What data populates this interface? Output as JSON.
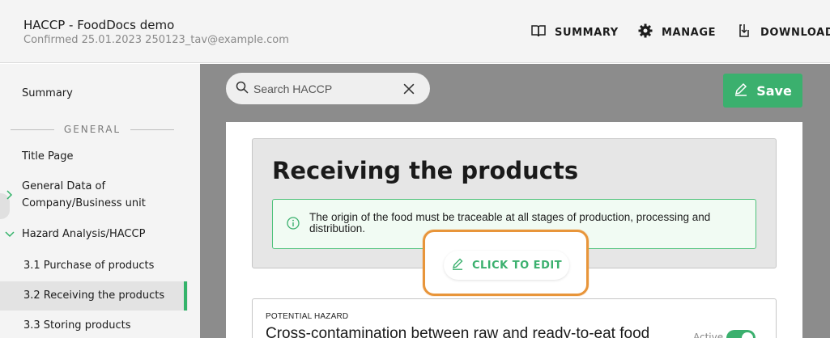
{
  "header": {
    "title": "HACCP - FoodDocs demo",
    "subtitle": "Confirmed 25.01.2023 250123_tav@example.com",
    "nav": {
      "summary": "SUMMARY",
      "manage": "MANAGE",
      "download": "DOWNLOAD"
    }
  },
  "sidebar": {
    "summary": "Summary",
    "section_general": "GENERAL",
    "title_page": "Title Page",
    "general_data_line1": "General Data of",
    "general_data_line2": "Company/Business unit",
    "hazard_analysis": "Hazard Analysis/HACCP",
    "sub_items": [
      {
        "label": "3.1 Purchase of products"
      },
      {
        "label": "3.2 Receiving the products",
        "active": true
      },
      {
        "label": "3.3 Storing products"
      }
    ]
  },
  "toolbar": {
    "search_placeholder": "Search HACCP",
    "save_label": "Save"
  },
  "step": {
    "title": "Receiving the products",
    "info_text": "The origin of the food must be traceable at all stages of production, processing and distribution.",
    "edit_label": "CLICK TO EDIT"
  },
  "hazard": {
    "label": "POTENTIAL HAZARD",
    "title": "Cross-contamination between raw and ready-to-eat food",
    "active_label": "Active"
  },
  "colors": {
    "accent_green": "#3bb06e",
    "highlight_orange": "#e8953a"
  }
}
